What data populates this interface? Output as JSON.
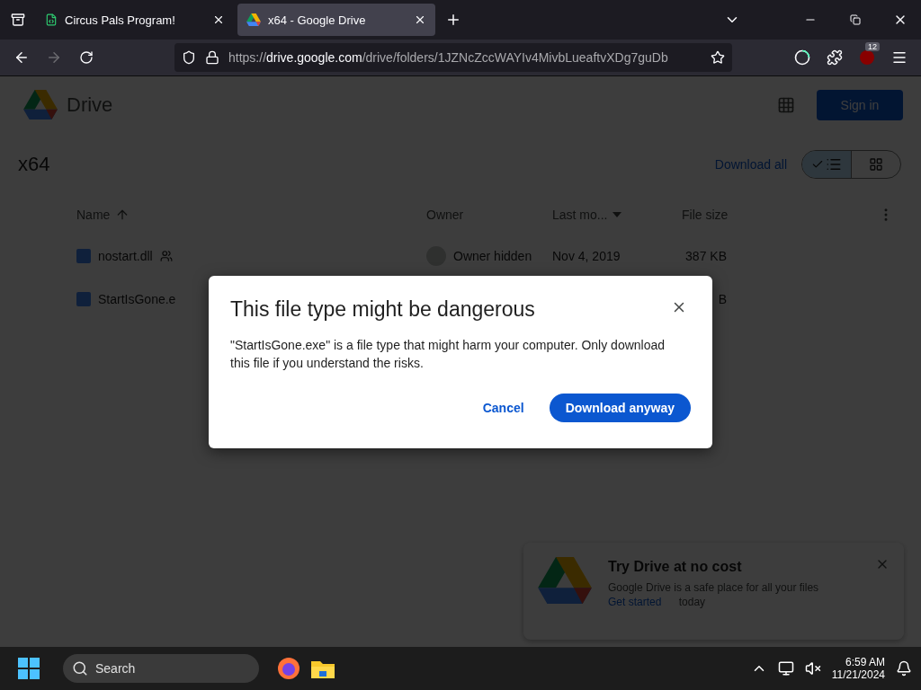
{
  "browser": {
    "tabs": [
      {
        "title": "Circus Pals Program!",
        "selected": false
      },
      {
        "title": "x64 - Google Drive",
        "selected": true
      }
    ],
    "url_host": "drive.google.com",
    "url_scheme": "https://",
    "url_path": "/drive/folders/1JZNcZccWAYIv4MivbLueaftvXDg7guDb",
    "extension_badge": "12"
  },
  "drive": {
    "brand": "Drive",
    "sign_in": "Sign in",
    "folder_title": "x64",
    "download_all": "Download all",
    "view_toggle": [
      {
        "kind": "list",
        "selected": true
      },
      {
        "kind": "grid",
        "selected": false
      }
    ],
    "columns": [
      "Name",
      "Owner",
      "Last mo...",
      "File size"
    ],
    "rows": [
      {
        "name": "nostart.dll",
        "shared": true,
        "owner": "Owner hidden",
        "modified": "Nov 4, 2019",
        "size": "387 KB"
      },
      {
        "name": "StartIsGone.e",
        "shared": false,
        "size": "B"
      }
    ],
    "promo": {
      "title": "Try Drive at no cost",
      "text": "Google Drive is a safe place for all your files",
      "link": "Get started",
      "suffix": " today"
    }
  },
  "dialog": {
    "title": "This file type might be dangerous",
    "message": "\"StartIsGone.exe\" is a file type that might harm your computer. Only download this file if you understand the risks.",
    "cancel": "Cancel",
    "confirm": "Download anyway"
  },
  "taskbar": {
    "search_placeholder": "Search",
    "time": "6:59 AM",
    "date": "11/21/2024"
  }
}
